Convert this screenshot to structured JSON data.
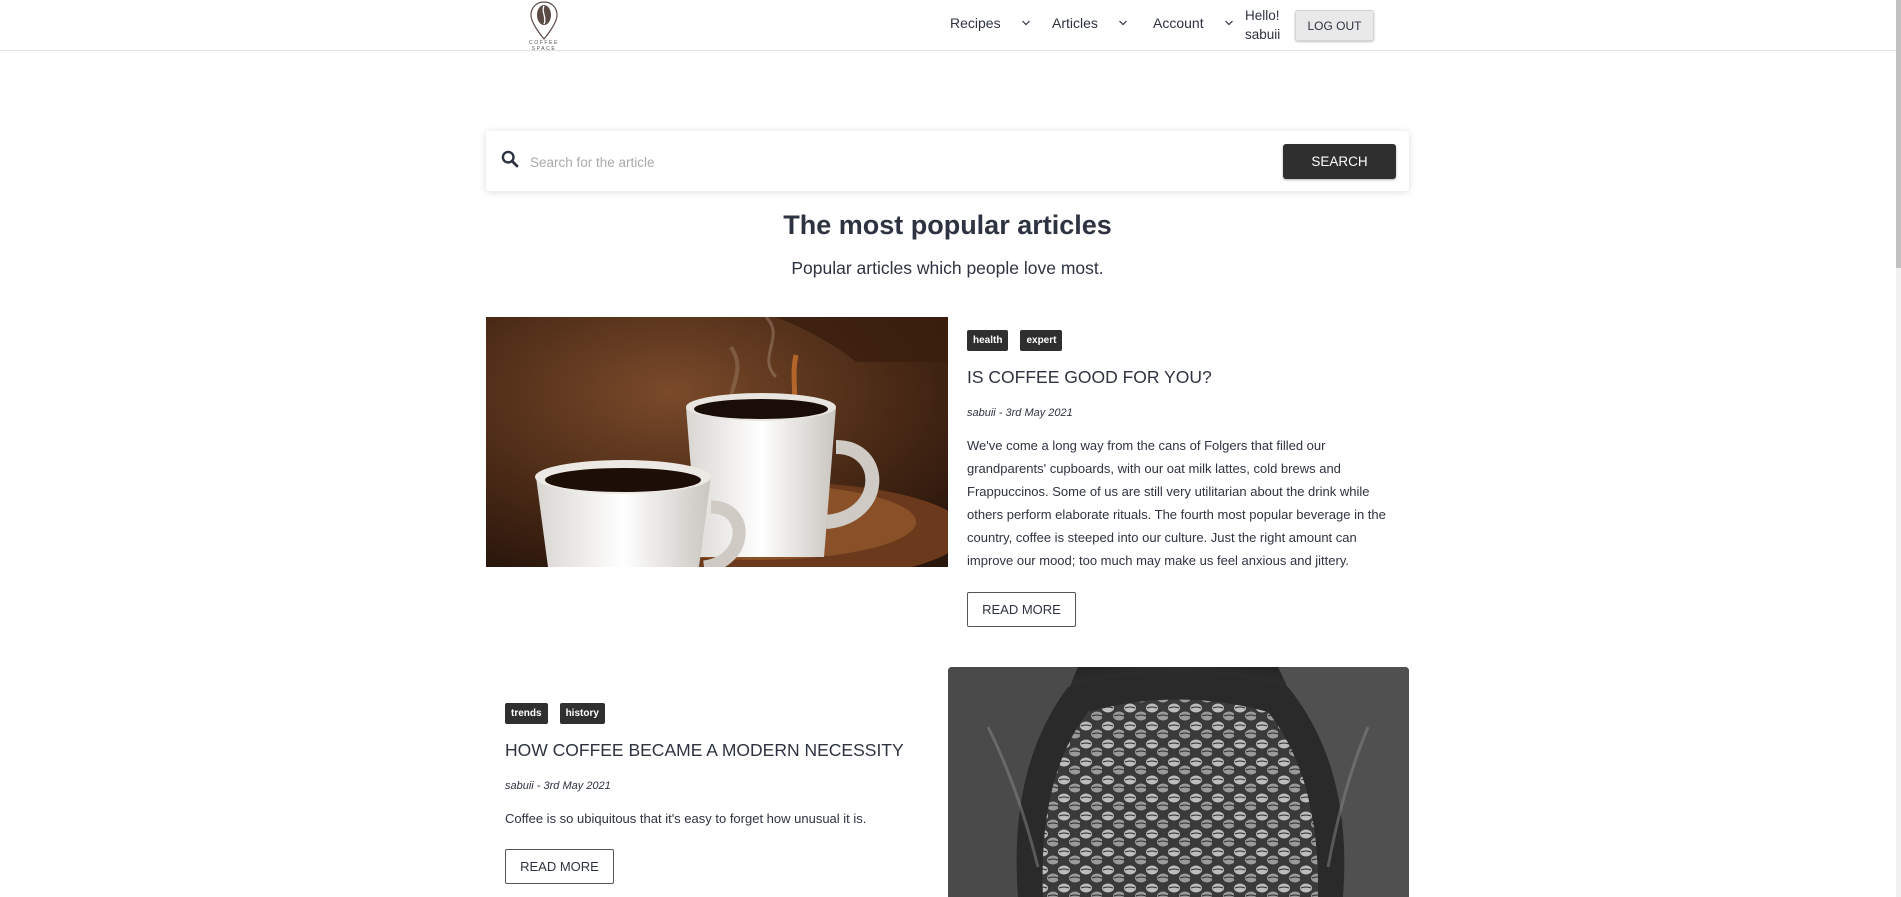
{
  "nav": {
    "logo_text": "COFFEE SPACE",
    "items": [
      {
        "label": "Recipes"
      },
      {
        "label": "Articles"
      },
      {
        "label": "Account"
      }
    ],
    "hello_label": "Hello!",
    "username": "sabuii",
    "logout_label": "LOG OUT"
  },
  "search": {
    "placeholder": "Search for the article",
    "value": "",
    "button_label": "SEARCH"
  },
  "section": {
    "title": "The most popular articles",
    "subtitle": "Popular articles which people love most."
  },
  "articles": [
    {
      "tags": [
        "health",
        "expert"
      ],
      "title": "IS COFFEE GOOD FOR YOU?",
      "meta": "sabuii - 3rd May 2021",
      "excerpt": "We've come a long way from the cans of Folgers that filled our grandparents' cupboards, with our oat milk lattes, cold brews and Frappuccinos. Some of us are still very utilitarian about the drink while others perform elaborate rituals. The fourth most popular beverage in the country, coffee is steeped into our culture. Just the right amount can improve our mood; too much may make us feel anxious and jittery.",
      "read_more": "READ MORE"
    },
    {
      "tags": [
        "trends",
        "history"
      ],
      "title": "HOW COFFEE BECAME A MODERN NECESSITY",
      "meta": "sabuii - 3rd May 2021",
      "excerpt": "Coffee is so ubiquitous that it's easy to forget how unusual it is.",
      "read_more": "READ MORE"
    }
  ],
  "colors": {
    "text": "#2d3340",
    "dark_button": "#2f2f2f",
    "tag_bg": "#2f2f2f",
    "divider": "#e2e2e2"
  },
  "icons": {
    "logo": "coffee-bean-pin-icon",
    "dropdown": "chevron-down-icon",
    "search": "search-icon"
  }
}
